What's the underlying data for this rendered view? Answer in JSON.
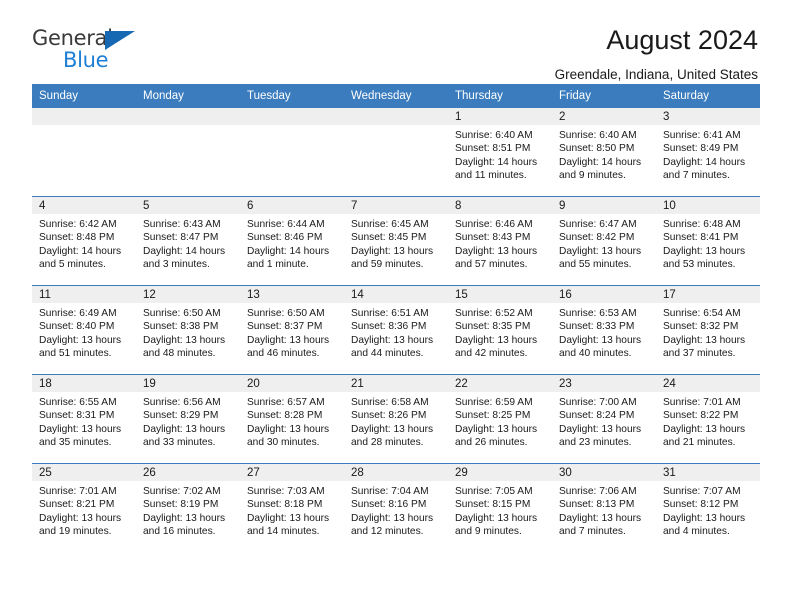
{
  "logo": {
    "word1": "General",
    "word2": "Blue",
    "triangle_color": "#1668b3",
    "blue_color": "#1f7fd4"
  },
  "header": {
    "title": "August 2024",
    "location": "Greendale, Indiana, United States"
  },
  "theme": {
    "header_blue": "#3a7cbe",
    "daynum_gray": "#efefef"
  },
  "weekdays": [
    "Sunday",
    "Monday",
    "Tuesday",
    "Wednesday",
    "Thursday",
    "Friday",
    "Saturday"
  ],
  "weeks": [
    [
      {
        "day": "",
        "empty": true
      },
      {
        "day": "",
        "empty": true
      },
      {
        "day": "",
        "empty": true
      },
      {
        "day": "",
        "empty": true
      },
      {
        "day": "1",
        "sunrise": "Sunrise: 6:40 AM",
        "sunset": "Sunset: 8:51 PM",
        "daylight": "Daylight: 14 hours and 11 minutes."
      },
      {
        "day": "2",
        "sunrise": "Sunrise: 6:40 AM",
        "sunset": "Sunset: 8:50 PM",
        "daylight": "Daylight: 14 hours and 9 minutes."
      },
      {
        "day": "3",
        "sunrise": "Sunrise: 6:41 AM",
        "sunset": "Sunset: 8:49 PM",
        "daylight": "Daylight: 14 hours and 7 minutes."
      }
    ],
    [
      {
        "day": "4",
        "sunrise": "Sunrise: 6:42 AM",
        "sunset": "Sunset: 8:48 PM",
        "daylight": "Daylight: 14 hours and 5 minutes."
      },
      {
        "day": "5",
        "sunrise": "Sunrise: 6:43 AM",
        "sunset": "Sunset: 8:47 PM",
        "daylight": "Daylight: 14 hours and 3 minutes."
      },
      {
        "day": "6",
        "sunrise": "Sunrise: 6:44 AM",
        "sunset": "Sunset: 8:46 PM",
        "daylight": "Daylight: 14 hours and 1 minute."
      },
      {
        "day": "7",
        "sunrise": "Sunrise: 6:45 AM",
        "sunset": "Sunset: 8:45 PM",
        "daylight": "Daylight: 13 hours and 59 minutes."
      },
      {
        "day": "8",
        "sunrise": "Sunrise: 6:46 AM",
        "sunset": "Sunset: 8:43 PM",
        "daylight": "Daylight: 13 hours and 57 minutes."
      },
      {
        "day": "9",
        "sunrise": "Sunrise: 6:47 AM",
        "sunset": "Sunset: 8:42 PM",
        "daylight": "Daylight: 13 hours and 55 minutes."
      },
      {
        "day": "10",
        "sunrise": "Sunrise: 6:48 AM",
        "sunset": "Sunset: 8:41 PM",
        "daylight": "Daylight: 13 hours and 53 minutes."
      }
    ],
    [
      {
        "day": "11",
        "sunrise": "Sunrise: 6:49 AM",
        "sunset": "Sunset: 8:40 PM",
        "daylight": "Daylight: 13 hours and 51 minutes."
      },
      {
        "day": "12",
        "sunrise": "Sunrise: 6:50 AM",
        "sunset": "Sunset: 8:38 PM",
        "daylight": "Daylight: 13 hours and 48 minutes."
      },
      {
        "day": "13",
        "sunrise": "Sunrise: 6:50 AM",
        "sunset": "Sunset: 8:37 PM",
        "daylight": "Daylight: 13 hours and 46 minutes."
      },
      {
        "day": "14",
        "sunrise": "Sunrise: 6:51 AM",
        "sunset": "Sunset: 8:36 PM",
        "daylight": "Daylight: 13 hours and 44 minutes."
      },
      {
        "day": "15",
        "sunrise": "Sunrise: 6:52 AM",
        "sunset": "Sunset: 8:35 PM",
        "daylight": "Daylight: 13 hours and 42 minutes."
      },
      {
        "day": "16",
        "sunrise": "Sunrise: 6:53 AM",
        "sunset": "Sunset: 8:33 PM",
        "daylight": "Daylight: 13 hours and 40 minutes."
      },
      {
        "day": "17",
        "sunrise": "Sunrise: 6:54 AM",
        "sunset": "Sunset: 8:32 PM",
        "daylight": "Daylight: 13 hours and 37 minutes."
      }
    ],
    [
      {
        "day": "18",
        "sunrise": "Sunrise: 6:55 AM",
        "sunset": "Sunset: 8:31 PM",
        "daylight": "Daylight: 13 hours and 35 minutes."
      },
      {
        "day": "19",
        "sunrise": "Sunrise: 6:56 AM",
        "sunset": "Sunset: 8:29 PM",
        "daylight": "Daylight: 13 hours and 33 minutes."
      },
      {
        "day": "20",
        "sunrise": "Sunrise: 6:57 AM",
        "sunset": "Sunset: 8:28 PM",
        "daylight": "Daylight: 13 hours and 30 minutes."
      },
      {
        "day": "21",
        "sunrise": "Sunrise: 6:58 AM",
        "sunset": "Sunset: 8:26 PM",
        "daylight": "Daylight: 13 hours and 28 minutes."
      },
      {
        "day": "22",
        "sunrise": "Sunrise: 6:59 AM",
        "sunset": "Sunset: 8:25 PM",
        "daylight": "Daylight: 13 hours and 26 minutes."
      },
      {
        "day": "23",
        "sunrise": "Sunrise: 7:00 AM",
        "sunset": "Sunset: 8:24 PM",
        "daylight": "Daylight: 13 hours and 23 minutes."
      },
      {
        "day": "24",
        "sunrise": "Sunrise: 7:01 AM",
        "sunset": "Sunset: 8:22 PM",
        "daylight": "Daylight: 13 hours and 21 minutes."
      }
    ],
    [
      {
        "day": "25",
        "sunrise": "Sunrise: 7:01 AM",
        "sunset": "Sunset: 8:21 PM",
        "daylight": "Daylight: 13 hours and 19 minutes."
      },
      {
        "day": "26",
        "sunrise": "Sunrise: 7:02 AM",
        "sunset": "Sunset: 8:19 PM",
        "daylight": "Daylight: 13 hours and 16 minutes."
      },
      {
        "day": "27",
        "sunrise": "Sunrise: 7:03 AM",
        "sunset": "Sunset: 8:18 PM",
        "daylight": "Daylight: 13 hours and 14 minutes."
      },
      {
        "day": "28",
        "sunrise": "Sunrise: 7:04 AM",
        "sunset": "Sunset: 8:16 PM",
        "daylight": "Daylight: 13 hours and 12 minutes."
      },
      {
        "day": "29",
        "sunrise": "Sunrise: 7:05 AM",
        "sunset": "Sunset: 8:15 PM",
        "daylight": "Daylight: 13 hours and 9 minutes."
      },
      {
        "day": "30",
        "sunrise": "Sunrise: 7:06 AM",
        "sunset": "Sunset: 8:13 PM",
        "daylight": "Daylight: 13 hours and 7 minutes."
      },
      {
        "day": "31",
        "sunrise": "Sunrise: 7:07 AM",
        "sunset": "Sunset: 8:12 PM",
        "daylight": "Daylight: 13 hours and 4 minutes."
      }
    ]
  ]
}
